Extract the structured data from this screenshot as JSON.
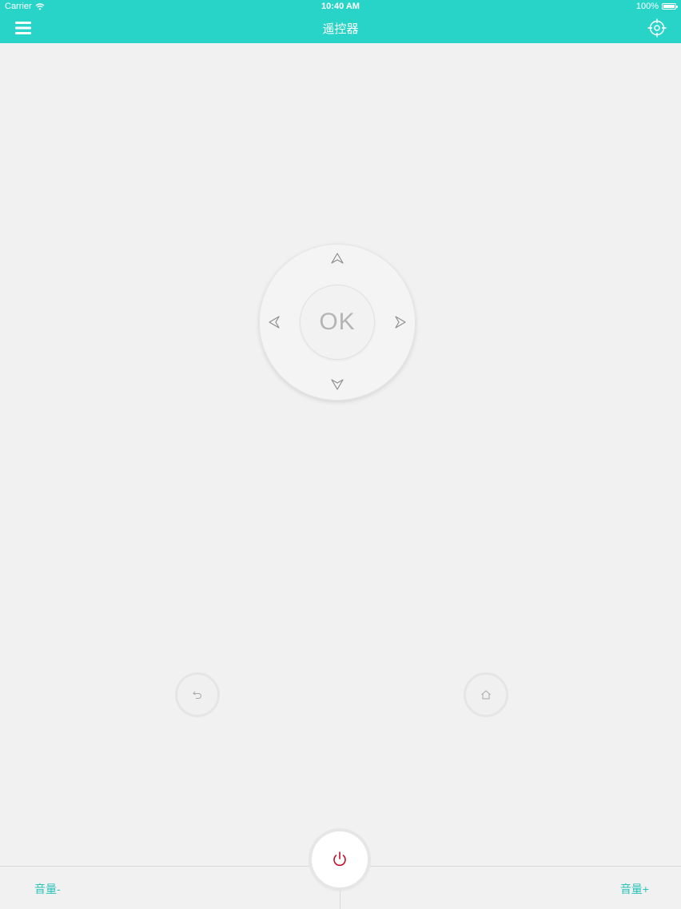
{
  "status_bar": {
    "carrier": "Carrier",
    "time": "10:40 AM",
    "battery_percent": "100%"
  },
  "nav": {
    "title": "遥控器",
    "left_icon": "menu-icon",
    "right_icon": "target-icon"
  },
  "dpad": {
    "ok_label": "OK",
    "up_icon": "arrow-up-icon",
    "down_icon": "arrow-down-icon",
    "left_icon": "arrow-left-icon",
    "right_icon": "arrow-right-icon"
  },
  "buttons": {
    "back_icon": "back-icon",
    "home_icon": "home-icon",
    "power_icon": "power-icon"
  },
  "bottom_bar": {
    "volume_down_label": "音量-",
    "volume_up_label": "音量+"
  },
  "colors": {
    "accent": "#28d4c8",
    "background": "#f2f1f2",
    "power": "#c0102c",
    "volume_text": "#28c4b8",
    "ok_text": "#b4b3b5"
  }
}
